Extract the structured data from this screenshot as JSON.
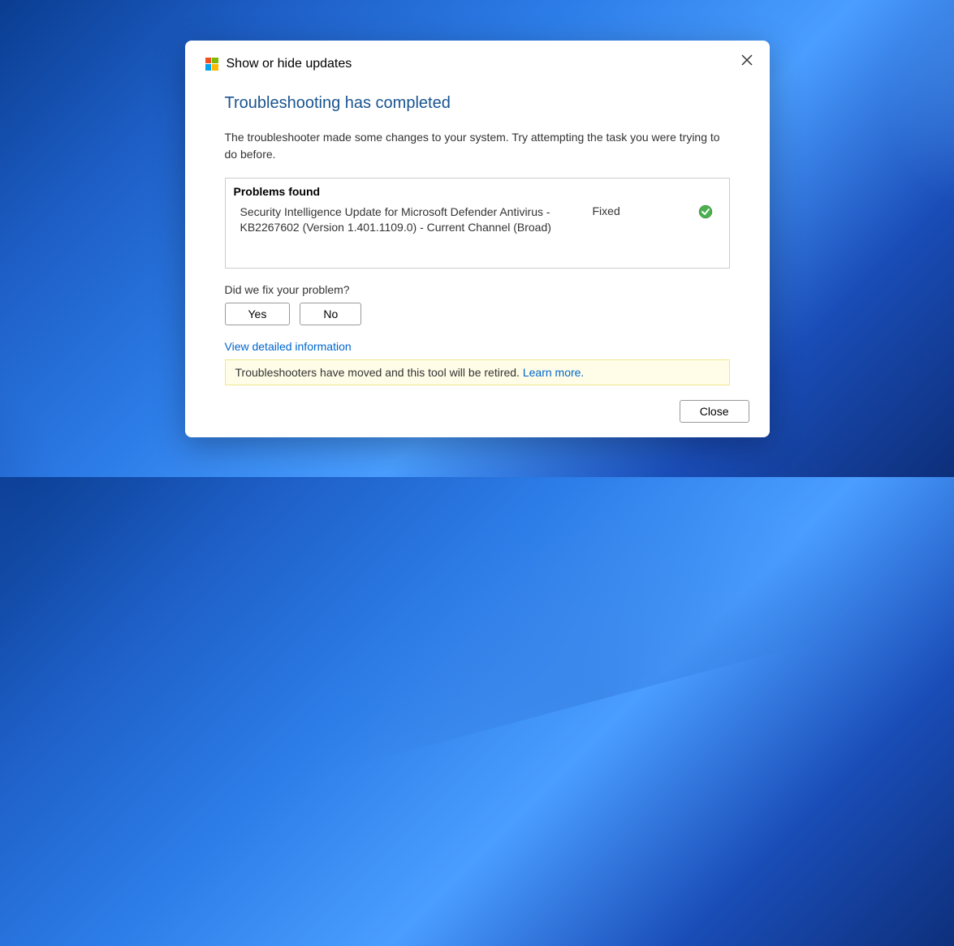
{
  "header": {
    "title": "Show or hide updates"
  },
  "main": {
    "title": "Troubleshooting has completed",
    "description": "The troubleshooter made some changes to your system. Try attempting the task you were trying to do before."
  },
  "problems": {
    "header": "Problems found",
    "items": [
      {
        "description": "Security Intelligence Update for Microsoft Defender Antivirus - KB2267602 (Version 1.401.1109.0) - Current Channel (Broad)",
        "status": "Fixed"
      }
    ]
  },
  "feedback": {
    "label": "Did we fix your problem?",
    "yes": "Yes",
    "no": "No"
  },
  "links": {
    "detail": "View detailed information",
    "learn": "Learn more."
  },
  "notice": {
    "text": "Troubleshooters have moved and this tool will be retired. "
  },
  "footer": {
    "close": "Close"
  }
}
